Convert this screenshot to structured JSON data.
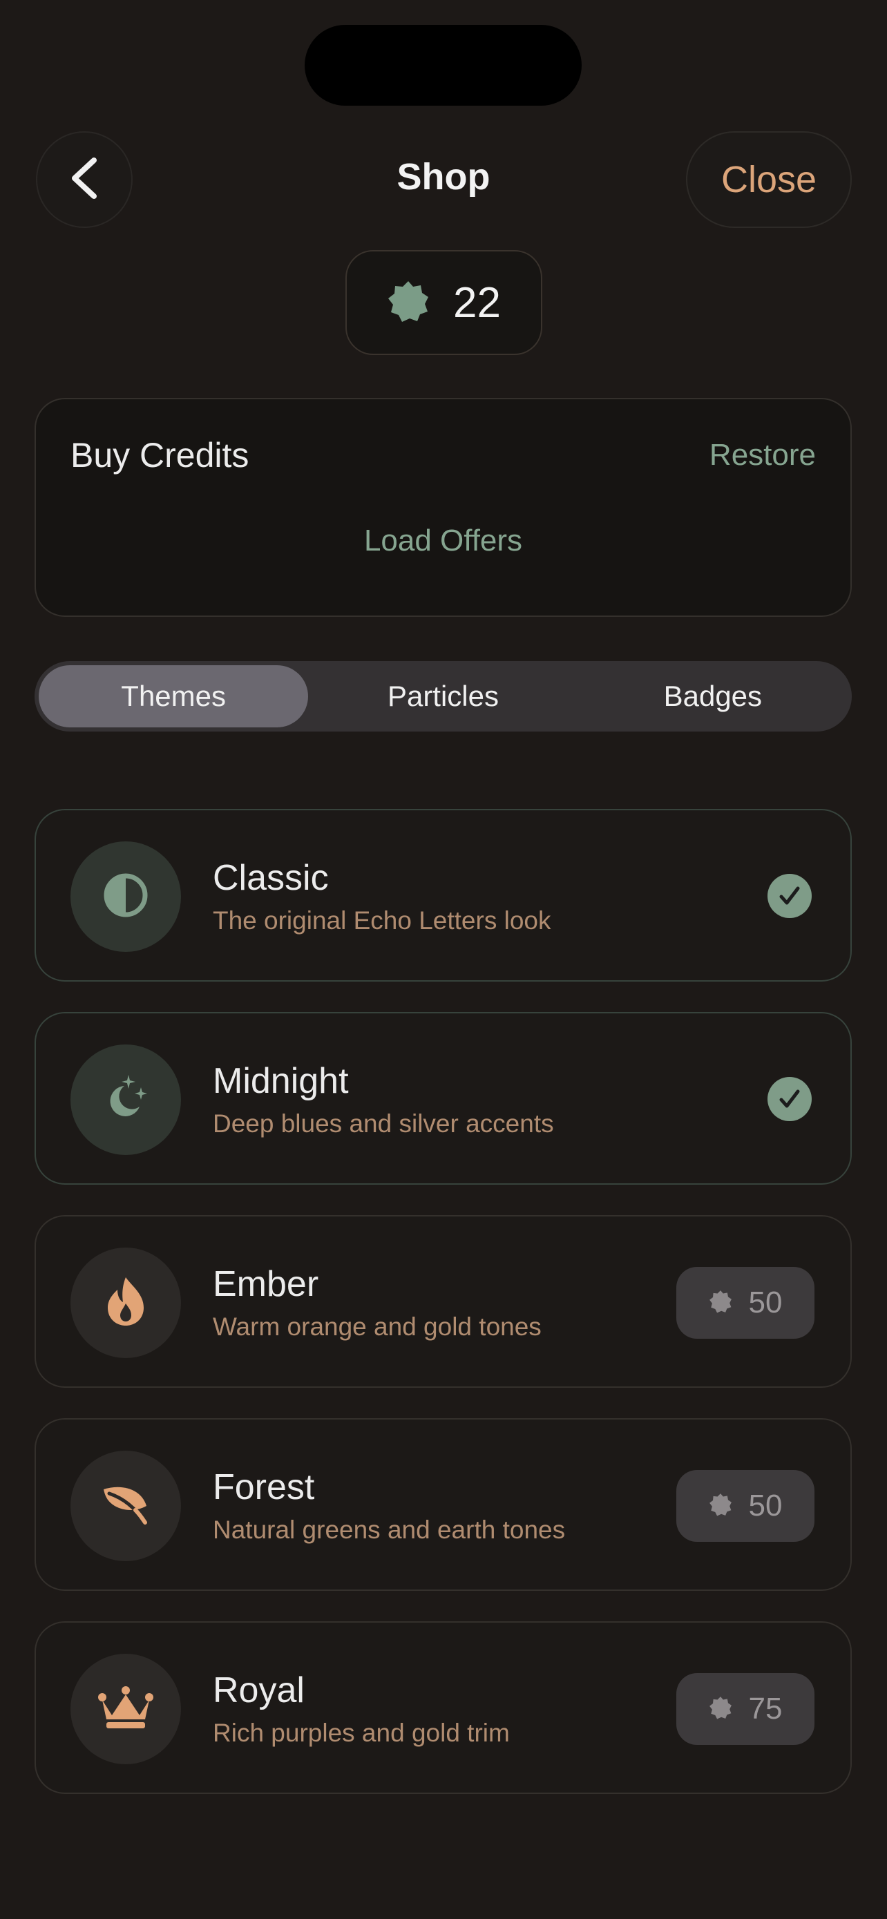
{
  "header": {
    "title": "Shop",
    "close_label": "Close"
  },
  "balance": {
    "amount": "22",
    "icon": "credit-badge-icon"
  },
  "buy_credits": {
    "heading": "Buy Credits",
    "restore_label": "Restore",
    "load_offers_label": "Load Offers"
  },
  "tabs": [
    {
      "label": "Themes",
      "active": true
    },
    {
      "label": "Particles",
      "active": false
    },
    {
      "label": "Badges",
      "active": false
    }
  ],
  "themes": [
    {
      "name": "Classic",
      "description": "The original Echo Letters look",
      "status": "owned",
      "icon": "half-circle-icon"
    },
    {
      "name": "Midnight",
      "description": "Deep blues and silver accents",
      "status": "owned",
      "icon": "moon-stars-icon"
    },
    {
      "name": "Ember",
      "description": "Warm orange and gold tones",
      "price": "50",
      "icon": "flame-icon"
    },
    {
      "name": "Forest",
      "description": "Natural greens and earth tones",
      "price": "50",
      "icon": "leaf-icon"
    },
    {
      "name": "Royal",
      "description": "Rich purples and gold trim",
      "price": "75",
      "icon": "crown-icon"
    }
  ],
  "colors": {
    "background": "#1d1917",
    "accent_green": "#86a590",
    "accent_orange": "#dca57a",
    "description_text": "#b08c70"
  }
}
